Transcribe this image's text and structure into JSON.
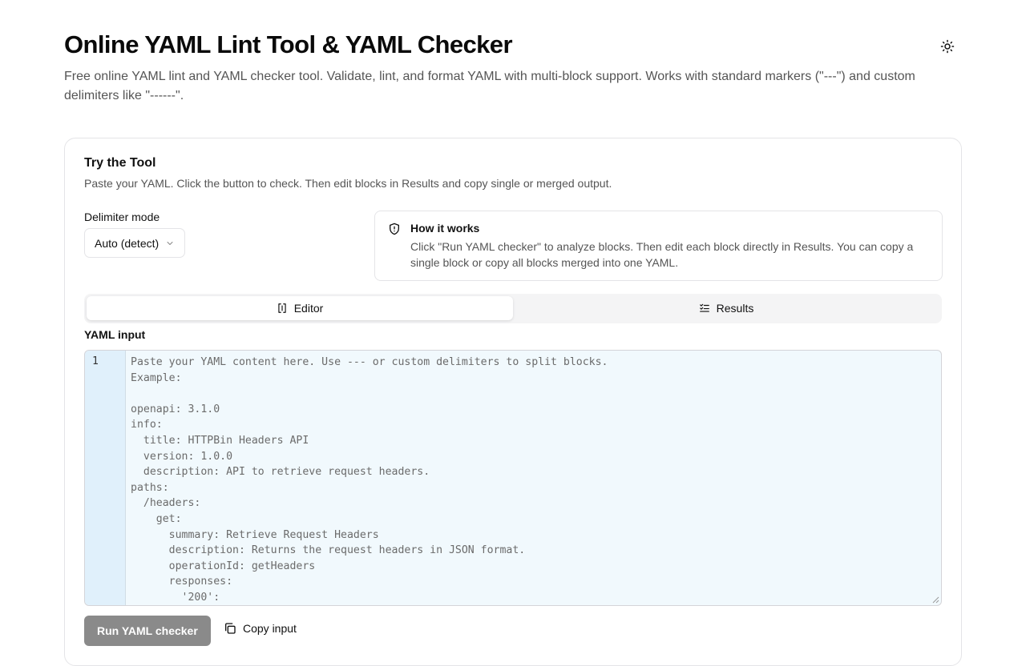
{
  "header": {
    "title": "Online YAML Lint Tool & YAML Checker",
    "subtitle": "Free online YAML lint and YAML checker tool. Validate, lint, and format YAML with multi-block support. Works with standard markers (\"---\") and custom delimiters like \"------\".",
    "theme_icon": "sun-icon"
  },
  "card": {
    "title": "Try the Tool",
    "description": "Paste your YAML. Click the button to check. Then edit blocks in Results and copy single or merged output."
  },
  "delimiter": {
    "label": "Delimiter mode",
    "selected": "Auto (detect)"
  },
  "how_it_works": {
    "icon": "shield-icon",
    "title": "How it works",
    "text": "Click \"Run YAML checker\" to analyze blocks. Then edit each block directly in Results. You can copy a single block or copy all blocks merged into one YAML."
  },
  "tabs": [
    {
      "label": "Editor",
      "icon": "editor-icon",
      "active": true
    },
    {
      "label": "Results",
      "icon": "checklist-icon",
      "active": false
    }
  ],
  "editor": {
    "label": "YAML input",
    "line_number": "1",
    "placeholder": "Paste your YAML content here. Use --- or custom delimiters to split blocks.\nExample:\n\nopenapi: 3.1.0\ninfo:\n  title: HTTPBin Headers API\n  version: 1.0.0\n  description: API to retrieve request headers.\npaths:\n  /headers:\n    get:\n      summary: Retrieve Request Headers\n      description: Returns the request headers in JSON format.\n      operationId: getHeaders\n      responses:\n        '200':"
  },
  "actions": {
    "run_label": "Run YAML checker",
    "copy_label": "Copy input",
    "copy_icon": "copy-icon"
  },
  "colors": {
    "editor_bg": "#f1f9fd",
    "gutter_bg": "#e0f0fb",
    "run_button_bg": "#8a8a8a",
    "border": "#e4e4e7"
  }
}
